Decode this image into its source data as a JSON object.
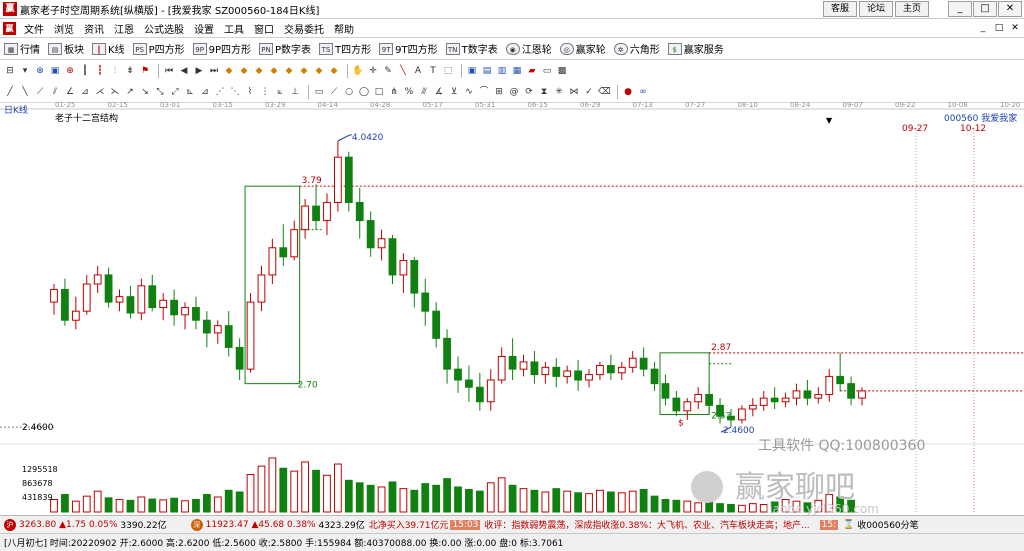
{
  "window": {
    "title": "赢家老子时空周期系统[纵横版] - [我爱我家  SZ000560-184日K线]",
    "links": [
      "客服",
      "论坛",
      "主页"
    ],
    "controls": [
      "_",
      "□",
      "✕"
    ]
  },
  "menu": {
    "items": [
      "文件",
      "浏览",
      "资讯",
      "江恩",
      "公式选股",
      "设置",
      "工具",
      "窗口",
      "交易委托",
      "帮助"
    ],
    "mdi_controls": [
      "_",
      "□",
      "✕"
    ]
  },
  "toolbar": {
    "items": [
      {
        "icon": "grid-icon",
        "glyph": "▦",
        "label": "行情"
      },
      {
        "icon": "blocks-icon",
        "glyph": "▤",
        "label": "板块"
      },
      {
        "icon": "kline-icon",
        "glyph": "┃",
        "label": "K线"
      },
      {
        "icon": "p-square-icon",
        "glyph": "PS",
        "label": "P四方形"
      },
      {
        "icon": "9p-square-icon",
        "glyph": "9P",
        "label": "9P四方形"
      },
      {
        "icon": "p-table-icon",
        "glyph": "PN",
        "label": "P数字表"
      },
      {
        "icon": "t-square-icon",
        "glyph": "TS",
        "label": "T四方形"
      },
      {
        "icon": "9t-square-icon",
        "glyph": "9T",
        "label": "9T四方形"
      },
      {
        "icon": "t-table-icon",
        "glyph": "TN",
        "label": "T数字表"
      },
      {
        "icon": "gann-wheel-icon",
        "glyph": "◉",
        "label": "江恩轮"
      },
      {
        "icon": "winner-wheel-icon",
        "glyph": "◎",
        "label": "赢家轮"
      },
      {
        "icon": "hexagon-icon",
        "glyph": "✲",
        "label": "六角形"
      },
      {
        "icon": "dollar-icon",
        "glyph": "$",
        "label": "赢家服务"
      }
    ]
  },
  "chart": {
    "period": "日K线",
    "name": "老子十二宫结构",
    "code_label": "000560  我爱我家",
    "date_ticks": [
      "01-25",
      "02-15",
      "03-01",
      "03-15",
      "03-29",
      "04-14",
      "04-28",
      "05-17",
      "05-31",
      "06-15",
      "06-29",
      "07-13",
      "07-27",
      "08-10",
      "08-24",
      "09-07",
      "09-22",
      "10-08",
      "10-20"
    ],
    "future_dates": [
      "09-27",
      "10-12"
    ],
    "annotations": {
      "high": "4.0420",
      "box1_top": "3.79",
      "box1_bottom": "2.70",
      "box2_top": "2.87",
      "box2_bottom": "2.53",
      "low": "2.4600",
      "price_floor": "2.4600",
      "dollar_mark": "$"
    },
    "volume_labels": [
      "1295518",
      "863678",
      "431839"
    ],
    "watermark": {
      "line1": "工具软件  QQ:100800360",
      "logo_text": "赢家聊吧",
      "url": "liaoba.yjcl360.com"
    },
    "colors": {
      "up": "#c00000",
      "down": "#108010",
      "box_line": "#108010",
      "dashed": "#c00000"
    }
  },
  "chart_data": {
    "type": "candlestick",
    "ylim": [
      2.4,
      4.1
    ],
    "candles": [
      [
        3.15,
        3.25,
        3.22,
        3.08
      ],
      [
        3.22,
        3.28,
        3.05,
        3.02
      ],
      [
        3.05,
        3.18,
        3.1,
        3.0
      ],
      [
        3.1,
        3.3,
        3.25,
        3.08
      ],
      [
        3.25,
        3.35,
        3.3,
        3.2
      ],
      [
        3.3,
        3.34,
        3.15,
        3.12
      ],
      [
        3.15,
        3.22,
        3.18,
        3.1
      ],
      [
        3.18,
        3.24,
        3.09,
        3.06
      ],
      [
        3.09,
        3.28,
        3.24,
        3.05
      ],
      [
        3.24,
        3.3,
        3.12,
        3.1
      ],
      [
        3.12,
        3.2,
        3.16,
        3.05
      ],
      [
        3.16,
        3.22,
        3.08,
        3.02
      ],
      [
        3.08,
        3.15,
        3.12,
        3.0
      ],
      [
        3.12,
        3.18,
        3.05,
        3.0
      ],
      [
        3.05,
        3.1,
        2.98,
        2.9
      ],
      [
        2.98,
        3.05,
        3.02,
        2.92
      ],
      [
        3.02,
        3.1,
        2.9,
        2.85
      ],
      [
        2.9,
        2.95,
        2.78,
        2.72
      ],
      [
        2.78,
        3.2,
        3.15,
        2.76
      ],
      [
        3.15,
        3.35,
        3.3,
        3.1
      ],
      [
        3.3,
        3.5,
        3.45,
        3.25
      ],
      [
        3.45,
        3.58,
        3.4,
        3.35
      ],
      [
        3.4,
        3.6,
        3.55,
        3.38
      ],
      [
        3.55,
        3.72,
        3.68,
        3.5
      ],
      [
        3.68,
        3.8,
        3.6,
        3.55
      ],
      [
        3.6,
        3.75,
        3.7,
        3.52
      ],
      [
        3.7,
        4.04,
        3.95,
        3.65
      ],
      [
        3.95,
        3.98,
        3.7,
        3.65
      ],
      [
        3.7,
        3.78,
        3.6,
        3.5
      ],
      [
        3.6,
        3.65,
        3.45,
        3.4
      ],
      [
        3.45,
        3.55,
        3.5,
        3.38
      ],
      [
        3.5,
        3.52,
        3.3,
        3.25
      ],
      [
        3.3,
        3.42,
        3.38,
        3.2
      ],
      [
        3.38,
        3.4,
        3.2,
        3.12
      ],
      [
        3.2,
        3.28,
        3.1,
        3.02
      ],
      [
        3.1,
        3.15,
        2.95,
        2.9
      ],
      [
        2.95,
        3.0,
        2.78,
        2.7
      ],
      [
        2.78,
        2.85,
        2.72,
        2.65
      ],
      [
        2.72,
        2.8,
        2.68,
        2.6
      ],
      [
        2.68,
        2.76,
        2.6,
        2.55
      ],
      [
        2.6,
        2.78,
        2.72,
        2.55
      ],
      [
        2.72,
        2.9,
        2.85,
        2.7
      ],
      [
        2.85,
        2.95,
        2.78,
        2.72
      ],
      [
        2.78,
        2.86,
        2.82,
        2.74
      ],
      [
        2.82,
        2.88,
        2.75,
        2.7
      ],
      [
        2.75,
        2.82,
        2.79,
        2.7
      ],
      [
        2.79,
        2.84,
        2.74,
        2.68
      ],
      [
        2.74,
        2.8,
        2.77,
        2.7
      ],
      [
        2.77,
        2.83,
        2.72,
        2.66
      ],
      [
        2.72,
        2.78,
        2.75,
        2.68
      ],
      [
        2.75,
        2.82,
        2.8,
        2.72
      ],
      [
        2.8,
        2.86,
        2.76,
        2.72
      ],
      [
        2.76,
        2.82,
        2.79,
        2.72
      ],
      [
        2.79,
        2.88,
        2.84,
        2.76
      ],
      [
        2.84,
        2.9,
        2.78,
        2.74
      ],
      [
        2.78,
        2.82,
        2.7,
        2.66
      ],
      [
        2.7,
        2.75,
        2.62,
        2.58
      ],
      [
        2.62,
        2.66,
        2.55,
        2.52
      ],
      [
        2.55,
        2.62,
        2.6,
        2.5
      ],
      [
        2.6,
        2.68,
        2.64,
        2.56
      ],
      [
        2.64,
        2.7,
        2.58,
        2.54
      ],
      [
        2.58,
        2.62,
        2.52,
        2.48
      ],
      [
        2.52,
        2.56,
        2.5,
        2.46
      ],
      [
        2.5,
        2.58,
        2.56,
        2.48
      ],
      [
        2.56,
        2.62,
        2.58,
        2.52
      ],
      [
        2.58,
        2.66,
        2.62,
        2.55
      ],
      [
        2.62,
        2.68,
        2.6,
        2.56
      ],
      [
        2.6,
        2.65,
        2.62,
        2.57
      ],
      [
        2.62,
        2.7,
        2.66,
        2.58
      ],
      [
        2.66,
        2.72,
        2.62,
        2.58
      ],
      [
        2.62,
        2.68,
        2.64,
        2.59
      ],
      [
        2.64,
        2.78,
        2.74,
        2.6
      ],
      [
        2.74,
        2.87,
        2.7,
        2.66
      ],
      [
        2.7,
        2.74,
        2.62,
        2.58
      ],
      [
        2.62,
        2.68,
        2.66,
        2.58
      ]
    ],
    "volume": [
      300,
      420,
      260,
      380,
      500,
      340,
      300,
      280,
      360,
      310,
      290,
      330,
      270,
      300,
      420,
      360,
      520,
      480,
      900,
      1100,
      1295,
      1050,
      980,
      1200,
      1000,
      880,
      1150,
      760,
      700,
      640,
      600,
      720,
      560,
      520,
      680,
      640,
      800,
      600,
      540,
      500,
      700,
      820,
      640,
      560,
      520,
      480,
      560,
      500,
      460,
      440,
      520,
      480,
      460,
      500,
      540,
      380,
      300,
      280,
      260,
      220,
      240,
      200,
      180,
      160,
      200,
      180,
      240,
      300,
      260,
      220,
      280,
      420,
      360,
      280
    ],
    "volume_ylim": [
      0,
      1300000
    ]
  },
  "status": {
    "sh_index": "3263.80",
    "sh_change": "▲1.75",
    "sh_pct": "0.05%",
    "sh_amount": "3390.22亿",
    "sz_index": "11923.47",
    "sz_change": "▲45.68",
    "sz_pct": "0.38%",
    "sz_amount": "4323.29亿",
    "north_flow": "北净买入39.71亿元",
    "time_tag": "15:03",
    "news": "收评：指数弱势震荡，深成指收涨0.38%：大飞机、农业、汽车板块走高；地产...",
    "right_tag": "15:",
    "right_text": "收000560分笔"
  },
  "infobar": {
    "text": "[八月初七] 时间:20220902 开:2.6000 高:2.6200 低:2.5600 收:2.5800 手:155984 额:40370088.00 换:0.00 涨:0.00 盘:0 标:3.7061"
  }
}
